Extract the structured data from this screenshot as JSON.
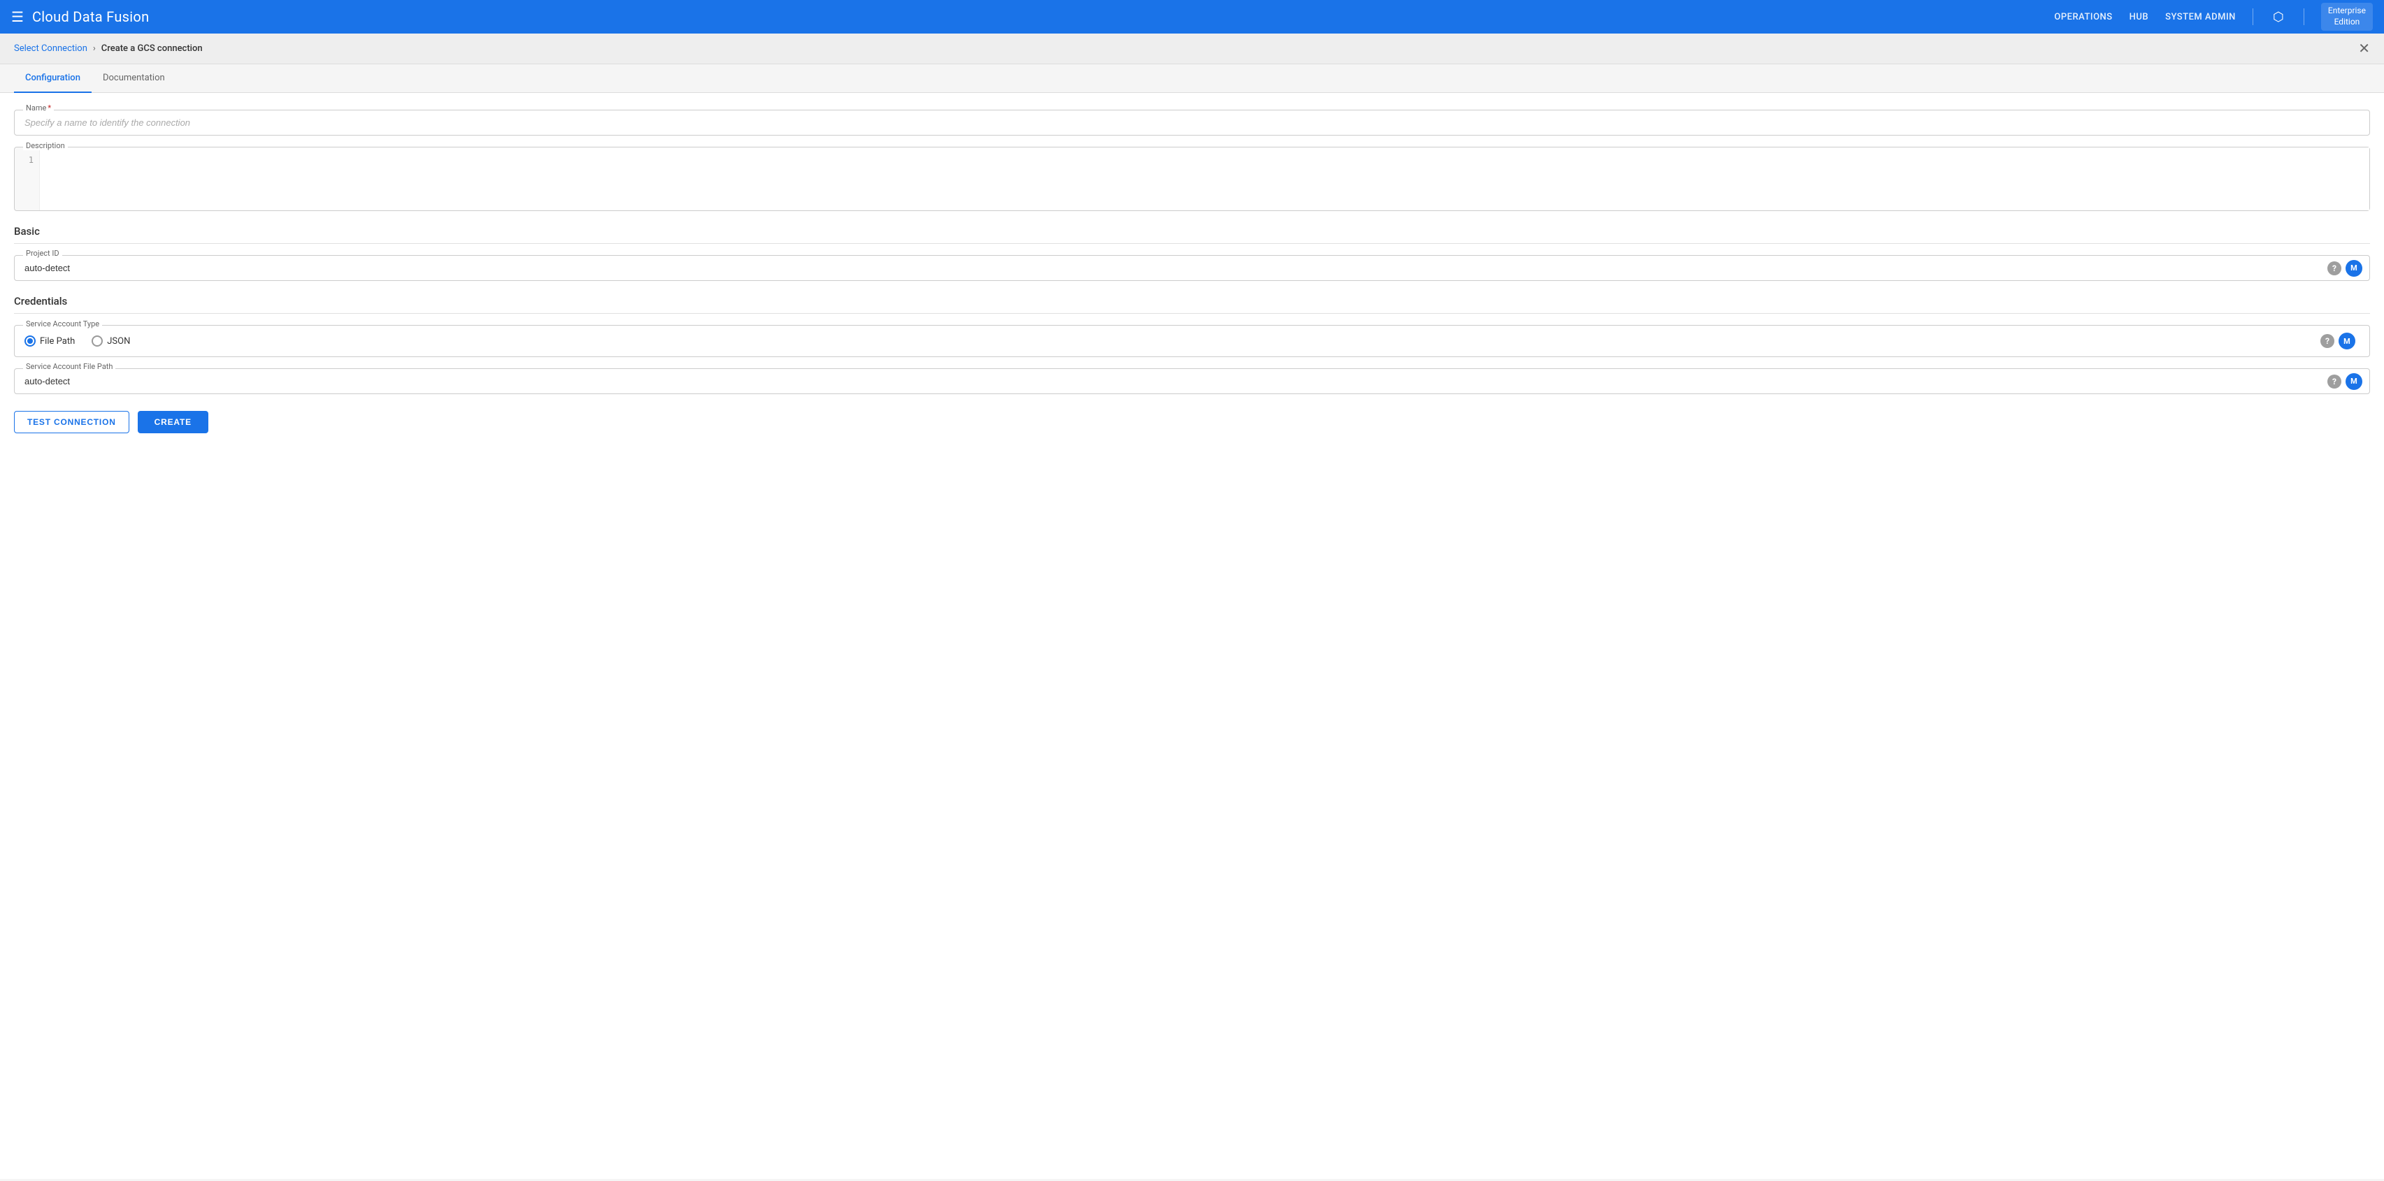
{
  "header": {
    "menu_icon": "☰",
    "logo": "Cloud Data Fusion",
    "nav": {
      "operations": "OPERATIONS",
      "hub": "HUB",
      "system_admin": "SYSTEM ADMIN"
    },
    "share_icon": "⬡",
    "enterprise": {
      "line1": "Enterprise",
      "line2": "Edition"
    }
  },
  "breadcrumb": {
    "link": "Select Connection",
    "separator": "›",
    "current": "Create a GCS connection",
    "close_icon": "✕"
  },
  "tabs": [
    {
      "label": "Configuration",
      "active": true
    },
    {
      "label": "Documentation",
      "active": false
    }
  ],
  "form": {
    "name_label": "Name",
    "name_required": "*",
    "name_placeholder": "Specify a name to identify the connection",
    "description_label": "Description",
    "description_line_number": "1",
    "basic_section": "Basic",
    "project_id_label": "Project ID",
    "project_id_value": "auto-detect",
    "credentials_section": "Credentials",
    "service_account_type_label": "Service Account Type",
    "radio_file_path": "File Path",
    "radio_json": "JSON",
    "service_account_file_path_label": "Service Account File Path",
    "service_account_file_path_value": "auto-detect",
    "help_icon": "?",
    "macro_icon": "M"
  },
  "buttons": {
    "test_connection": "TEST CONNECTION",
    "create": "CREATE"
  }
}
